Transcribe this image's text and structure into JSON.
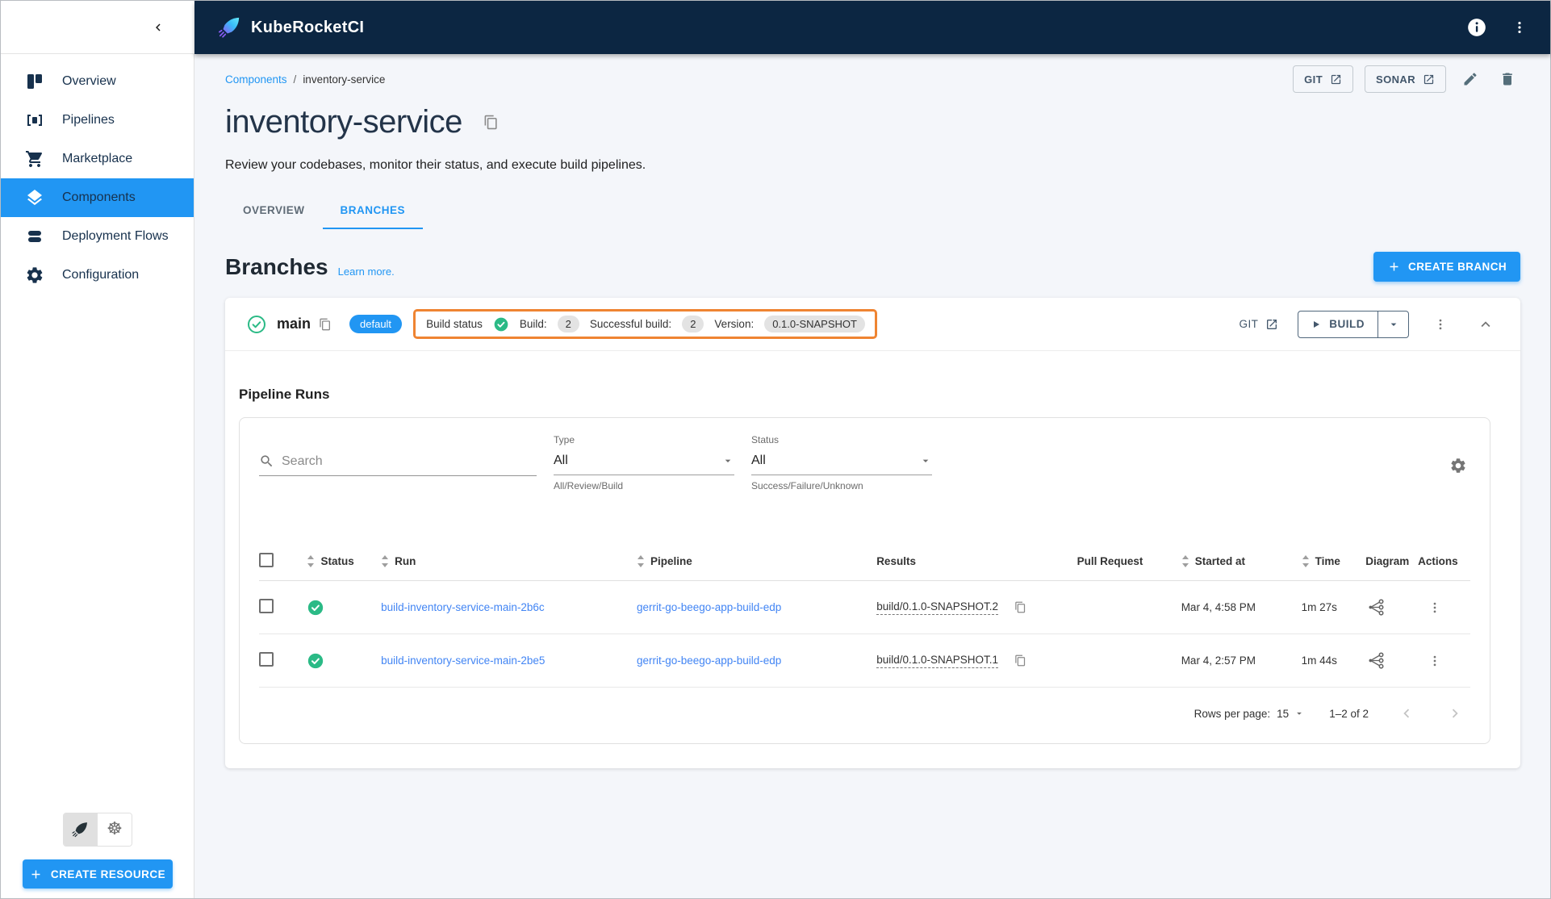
{
  "header": {
    "app_title": "KubeRocketCI"
  },
  "sidebar": {
    "items": [
      {
        "label": "Overview"
      },
      {
        "label": "Pipelines"
      },
      {
        "label": "Marketplace"
      },
      {
        "label": "Components"
      },
      {
        "label": "Deployment Flows"
      },
      {
        "label": "Configuration"
      }
    ],
    "create_resource_label": "CREATE RESOURCE"
  },
  "breadcrumb": {
    "parent": "Components",
    "separator": "/",
    "current": "inventory-service"
  },
  "page_actions": {
    "git_label": "GIT",
    "sonar_label": "SONAR"
  },
  "page": {
    "title": "inventory-service",
    "subtitle": "Review your codebases, monitor their status, and execute build pipelines."
  },
  "tabs": {
    "overview": "OVERVIEW",
    "branches": "BRANCHES"
  },
  "branches_section": {
    "heading": "Branches",
    "learn_more_label": "Learn more.",
    "create_branch_label": "CREATE BRANCH"
  },
  "branch": {
    "name": "main",
    "default_badge": "default",
    "build_status_label": "Build status",
    "build_label": "Build:",
    "build_count": "2",
    "successful_build_label": "Successful build:",
    "successful_build_count": "2",
    "version_label": "Version:",
    "version_value": "0.1.0-SNAPSHOT",
    "git_label": "GIT",
    "build_button_label": "BUILD"
  },
  "pipeline_runs": {
    "heading": "Pipeline Runs",
    "filters": {
      "search_placeholder": "Search",
      "type_label": "Type",
      "type_value": "All",
      "type_helper": "All/Review/Build",
      "status_label": "Status",
      "status_value": "All",
      "status_helper": "Success/Failure/Unknown"
    },
    "table": {
      "columns": [
        "Status",
        "Run",
        "Pipeline",
        "Results",
        "Pull Request",
        "Started at",
        "Time",
        "Diagram",
        "Actions"
      ],
      "rows": [
        {
          "status": "success",
          "run": "build-inventory-service-main-2b6c",
          "pipeline": "gerrit-go-beego-app-build-edp",
          "results": "build/0.1.0-SNAPSHOT.2",
          "started_at": "Mar 4, 4:58 PM",
          "time": "1m 27s"
        },
        {
          "status": "success",
          "run": "build-inventory-service-main-2be5",
          "pipeline": "gerrit-go-beego-app-build-edp",
          "results": "build/0.1.0-SNAPSHOT.1",
          "started_at": "Mar 4, 2:57 PM",
          "time": "1m 44s"
        }
      ]
    },
    "pagination": {
      "rows_per_page_label": "Rows per page:",
      "rows_per_page_value": "15",
      "range_text": "1–2 of 2"
    }
  },
  "colors": {
    "header_navy": "#0c2642",
    "accent_blue": "#2196f3",
    "success_green": "#2bba86",
    "highlight_orange": "#ef8432",
    "link_blue": "#4285f4"
  }
}
